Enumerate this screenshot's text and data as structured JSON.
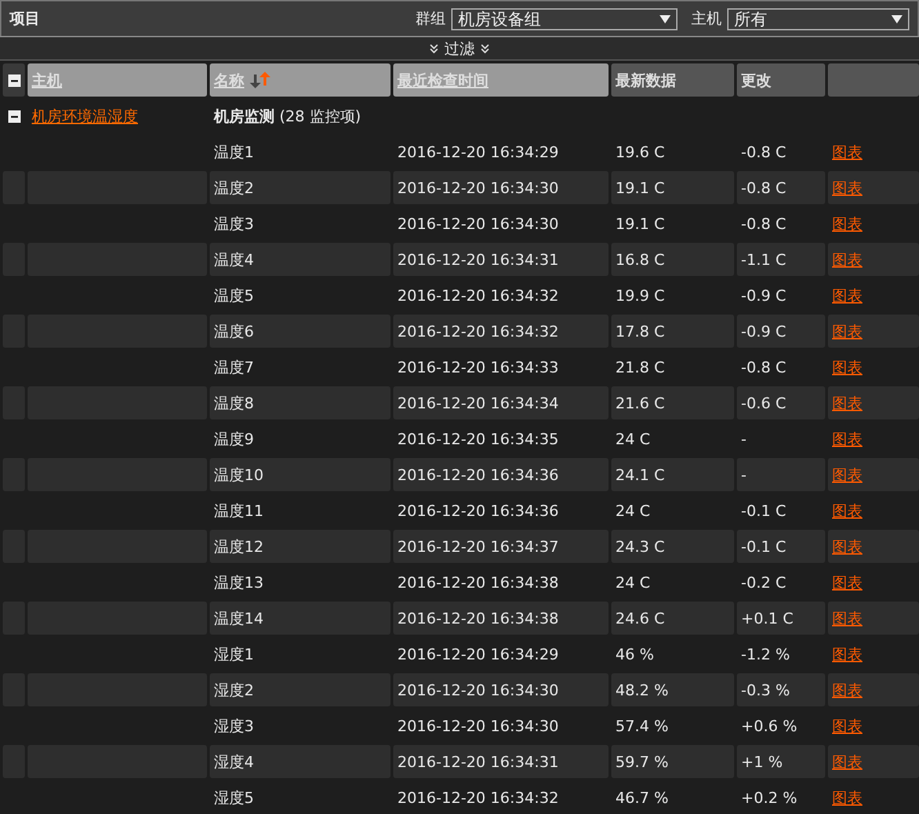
{
  "toolbar": {
    "title": "项目",
    "filters": [
      {
        "label": "群组",
        "value": "机房设备组"
      },
      {
        "label": "主机",
        "value": "所有"
      }
    ]
  },
  "filter_toggle": {
    "label": "过滤"
  },
  "table": {
    "columns": [
      {
        "label": "主机",
        "sortable": true,
        "sorted": false
      },
      {
        "label": "名称",
        "sortable": true,
        "sorted": true
      },
      {
        "label": "最近检查时间",
        "sortable": true,
        "sorted": false
      },
      {
        "label": "最新数据",
        "sortable": false,
        "sorted": false
      },
      {
        "label": "更改",
        "sortable": false,
        "sorted": false
      },
      {
        "sortable": false,
        "sorted": false
      }
    ],
    "group": {
      "host": "机房环境温湿度",
      "name": "机房监测",
      "count": "(28 监控项)",
      "expanded": true
    },
    "rows": [
      {
        "name": "温度1",
        "time": "2016-12-20 16:34:29",
        "value": "19.6 C",
        "change": "-0.8 C",
        "link": "图表"
      },
      {
        "name": "温度2",
        "time": "2016-12-20 16:34:30",
        "value": "19.1 C",
        "change": "-0.8 C",
        "link": "图表"
      },
      {
        "name": "温度3",
        "time": "2016-12-20 16:34:30",
        "value": "19.1 C",
        "change": "-0.8 C",
        "link": "图表"
      },
      {
        "name": "温度4",
        "time": "2016-12-20 16:34:31",
        "value": "16.8 C",
        "change": "-1.1 C",
        "link": "图表"
      },
      {
        "name": "温度5",
        "time": "2016-12-20 16:34:32",
        "value": "19.9 C",
        "change": "-0.9 C",
        "link": "图表"
      },
      {
        "name": "温度6",
        "time": "2016-12-20 16:34:32",
        "value": "17.8 C",
        "change": "-0.9 C",
        "link": "图表"
      },
      {
        "name": "温度7",
        "time": "2016-12-20 16:34:33",
        "value": "21.8 C",
        "change": "-0.8 C",
        "link": "图表"
      },
      {
        "name": "温度8",
        "time": "2016-12-20 16:34:34",
        "value": "21.6 C",
        "change": "-0.6 C",
        "link": "图表"
      },
      {
        "name": "温度9",
        "time": "2016-12-20 16:34:35",
        "value": "24 C",
        "change": "-",
        "link": "图表"
      },
      {
        "name": "温度10",
        "time": "2016-12-20 16:34:36",
        "value": "24.1 C",
        "change": "-",
        "link": "图表"
      },
      {
        "name": "温度11",
        "time": "2016-12-20 16:34:36",
        "value": "24 C",
        "change": "-0.1 C",
        "link": "图表"
      },
      {
        "name": "温度12",
        "time": "2016-12-20 16:34:37",
        "value": "24.3 C",
        "change": "-0.1 C",
        "link": "图表"
      },
      {
        "name": "温度13",
        "time": "2016-12-20 16:34:38",
        "value": "24 C",
        "change": "-0.2 C",
        "link": "图表"
      },
      {
        "name": "温度14",
        "time": "2016-12-20 16:34:38",
        "value": "24.6 C",
        "change": "+0.1 C",
        "link": "图表"
      },
      {
        "name": "湿度1",
        "time": "2016-12-20 16:34:29",
        "value": "46 %",
        "change": "-1.2 %",
        "link": "图表"
      },
      {
        "name": "湿度2",
        "time": "2016-12-20 16:34:30",
        "value": "48.2 %",
        "change": "-0.3 %",
        "link": "图表"
      },
      {
        "name": "湿度3",
        "time": "2016-12-20 16:34:30",
        "value": "57.4 %",
        "change": "+0.6 %",
        "link": "图表"
      },
      {
        "name": "湿度4",
        "time": "2016-12-20 16:34:31",
        "value": "59.7 %",
        "change": "+1 %",
        "link": "图表"
      },
      {
        "name": "湿度5",
        "time": "2016-12-20 16:34:32",
        "value": "46.7 %",
        "change": "+0.2 %",
        "link": "图表"
      }
    ]
  }
}
